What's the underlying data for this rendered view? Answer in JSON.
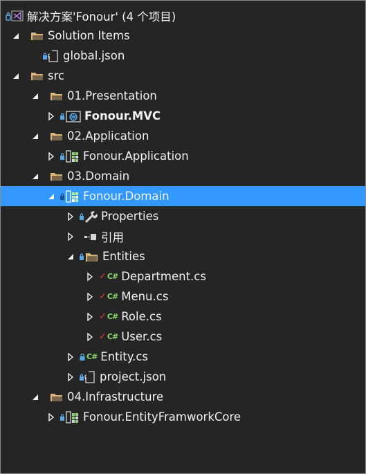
{
  "solution": {
    "label": "解决方案'Fonour' (4 个项目)",
    "icon": "vs-solution-icon"
  },
  "tree": {
    "solution_items": {
      "label": "Solution Items",
      "icon": "folder-icon",
      "expanded": true
    },
    "global_json": {
      "label": "global.json",
      "icon": "json-file-icon"
    },
    "src": {
      "label": "src",
      "icon": "folder-icon",
      "expanded": true
    },
    "presentation": {
      "label": "01.Presentation",
      "icon": "folder-icon",
      "expanded": true
    },
    "mvc": {
      "label": "Fonour.MVC",
      "icon": "web-project-icon",
      "expanded": false
    },
    "application_folder": {
      "label": "02.Application",
      "icon": "folder-icon",
      "expanded": true
    },
    "application_project": {
      "label": "Fonour.Application",
      "icon": "class-library-icon",
      "expanded": false
    },
    "domain_folder": {
      "label": "03.Domain",
      "icon": "folder-icon",
      "expanded": true
    },
    "domain_project": {
      "label": "Fonour.Domain",
      "icon": "class-library-icon",
      "expanded": true,
      "selected": true
    },
    "properties": {
      "label": "Properties",
      "icon": "wrench-icon",
      "expanded": false
    },
    "references": {
      "label": "引用",
      "icon": "references-icon",
      "expanded": false
    },
    "entities": {
      "label": "Entities",
      "icon": "folder-icon",
      "expanded": true
    },
    "department": {
      "label": "Department.cs",
      "icon": "csharp-file-icon",
      "checked_in": true
    },
    "menu": {
      "label": "Menu.cs",
      "icon": "csharp-file-icon",
      "checked_in": true
    },
    "role": {
      "label": "Role.cs",
      "icon": "csharp-file-icon",
      "checked_in": true
    },
    "user": {
      "label": "User.cs",
      "icon": "csharp-file-icon",
      "checked_in": true
    },
    "entity": {
      "label": "Entity.cs",
      "icon": "csharp-file-icon"
    },
    "project_json": {
      "label": "project.json",
      "icon": "json-file-icon"
    },
    "infrastructure": {
      "label": "04.Infrastructure",
      "icon": "folder-icon",
      "expanded": true
    },
    "efcore": {
      "label": "Fonour.EntityFramworkCore",
      "icon": "class-library-icon",
      "expanded": false
    }
  },
  "colors": {
    "background": "#252526",
    "text": "#f1f1f1",
    "selection": "#3399ff",
    "folder": "#dcb67a",
    "lock": "#5aa7e6",
    "csharp": "#8bd86f",
    "check": "#e53935"
  }
}
